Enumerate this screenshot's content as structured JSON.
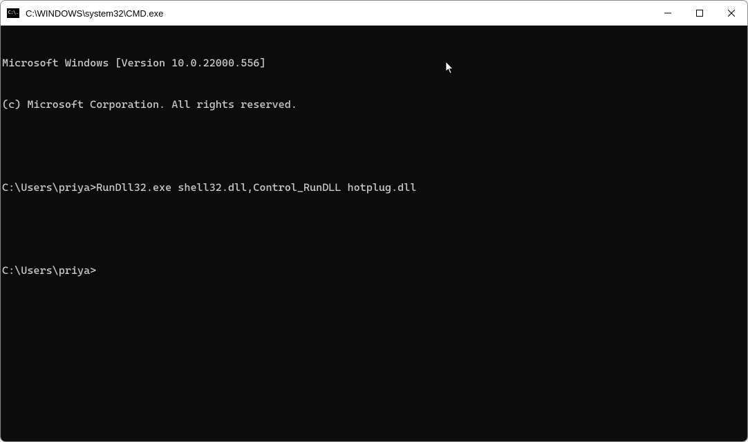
{
  "window": {
    "title": "C:\\WINDOWS\\system32\\CMD.exe",
    "icon_text": "C:\\."
  },
  "terminal": {
    "lines": [
      {
        "type": "text",
        "text": "Microsoft Windows [Version 10.0.22000.556]"
      },
      {
        "type": "text",
        "text": "(c) Microsoft Corporation. All rights reserved."
      },
      {
        "type": "blank",
        "text": ""
      },
      {
        "type": "promptcmd",
        "prompt": "C:\\Users\\priya>",
        "command": "RunDll32.exe shell32.dll,Control_RunDLL hotplug.dll"
      },
      {
        "type": "blank",
        "text": ""
      },
      {
        "type": "promptcmd",
        "prompt": "C:\\Users\\priya>",
        "command": ""
      }
    ]
  }
}
